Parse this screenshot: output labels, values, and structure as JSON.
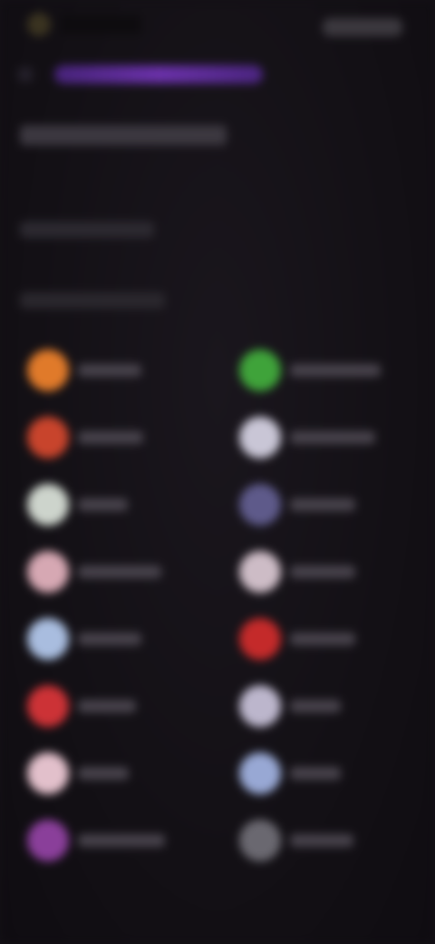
{
  "status_bar": {
    "app_icon": "app-icon"
  },
  "tabs": {
    "active_color": "#6a31a9"
  },
  "colors": {
    "background": "#141116",
    "accent": "#6a31a9"
  },
  "languages": [
    {
      "flag_color": "#e07a2a"
    },
    {
      "flag_color": "#3fa33a"
    },
    {
      "flag_color": "#c8442c"
    },
    {
      "flag_color": "#c9c6d6"
    },
    {
      "flag_color": "#cdd4cc"
    },
    {
      "flag_color": "#5e5a8a"
    },
    {
      "flag_color": "#d6a8b3"
    },
    {
      "flag_color": "#cdbcc6"
    },
    {
      "flag_color": "#a9bddf"
    },
    {
      "flag_color": "#c42a2a"
    },
    {
      "flag_color": "#cc3236"
    },
    {
      "flag_color": "#bcb6cc"
    },
    {
      "flag_color": "#e2c0cb"
    },
    {
      "flag_color": "#98a8d4"
    },
    {
      "flag_color": "#8a3f9a"
    },
    {
      "flag_color": "#6a6870"
    }
  ]
}
